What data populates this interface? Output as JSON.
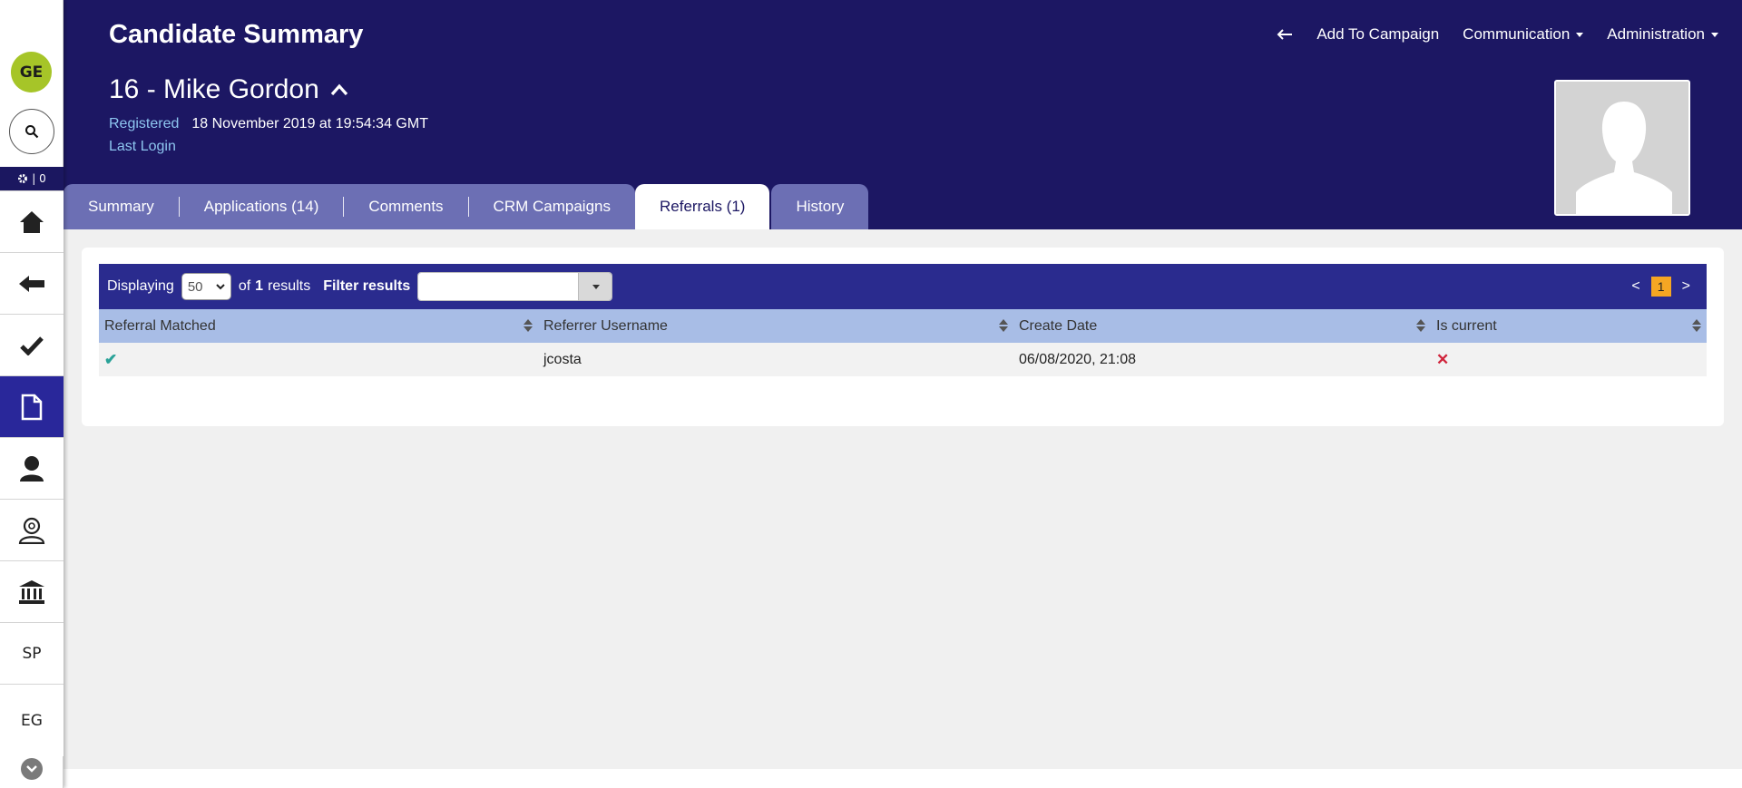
{
  "sidebar": {
    "avatar_initials": "GE",
    "settings_count": "| 0",
    "items": [
      {
        "icon": "home-icon"
      },
      {
        "icon": "back-arrow-icon"
      },
      {
        "icon": "check-icon"
      },
      {
        "icon": "document-icon",
        "active": true
      },
      {
        "icon": "person-icon"
      },
      {
        "icon": "person-search-icon"
      },
      {
        "icon": "bank-icon"
      },
      {
        "label": "SP"
      },
      {
        "label": "EG"
      }
    ]
  },
  "header": {
    "title": "Candidate Summary",
    "candidate_name": "16 - Mike Gordon",
    "registered_label": "Registered",
    "registered_value": "18 November 2019 at 19:54:34 GMT",
    "last_login_label": "Last Login",
    "actions": {
      "add_to_campaign": "Add To Campaign",
      "communication": "Communication",
      "administration": "Administration"
    }
  },
  "tabs": [
    {
      "label": "Summary"
    },
    {
      "label": "Applications (14)"
    },
    {
      "label": "Comments"
    },
    {
      "label": "CRM Campaigns"
    },
    {
      "label": "Referrals (1)",
      "active": true
    },
    {
      "label": "History"
    }
  ],
  "toolbar": {
    "displaying_label": "Displaying",
    "page_size": "50",
    "of_label": "of",
    "result_count": "1",
    "results_label": "results",
    "filter_label": "Filter results",
    "filter_value": "",
    "pager_prev": "<",
    "pager_current": "1",
    "pager_next": ">"
  },
  "table": {
    "columns": [
      "Referral Matched",
      "Referrer Username",
      "Create Date",
      "Is current"
    ],
    "rows": [
      {
        "referral_matched": "✔",
        "referrer_username": "jcosta",
        "create_date": "06/08/2020, 21:08",
        "is_current": "✕"
      }
    ]
  },
  "colors": {
    "header_bg": "#1c1763",
    "tab_bg": "#6c6fb4",
    "toolbar_bg": "#2a2b8e",
    "table_head_bg": "#a8bde6",
    "avatar_bg": "#a6c528",
    "pager_active": "#f5a623",
    "check_color": "#2aa298",
    "cross_color": "#d0243b"
  }
}
